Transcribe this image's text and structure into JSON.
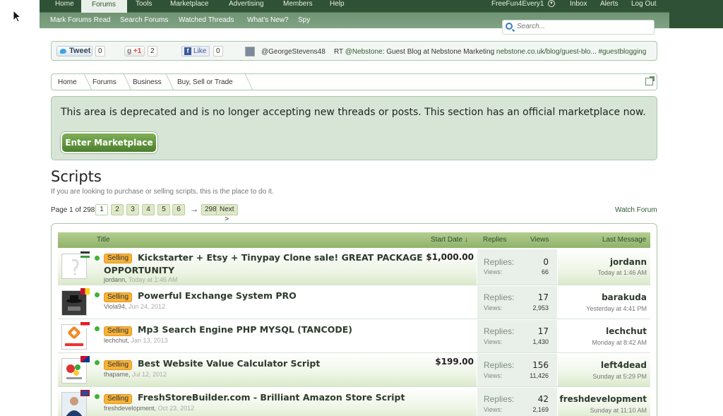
{
  "nav": {
    "items": [
      "Home",
      "Forums",
      "Tools",
      "Marketplace",
      "Advertising",
      "Members",
      "Help"
    ],
    "user": "FreeFun4Every1",
    "inbox": "Inbox",
    "alerts": "Alerts",
    "logout": "Log Out",
    "sub": [
      "Mark Forums Read",
      "Search Forums",
      "Watched Threads",
      "What's New?",
      "Spy"
    ]
  },
  "search": {
    "placeholder": "Search..."
  },
  "social": {
    "tweet": "Tweet",
    "tweet_count": "0",
    "gplus": "+1",
    "gplus_count": "2",
    "like": "Like",
    "like_count": "0",
    "tw_user": "@GeorgeStevens48",
    "tw_rt": "RT",
    "tw_mention": "@Nebstone",
    "tw_msg": ": Guest Blog at Nebstone Marketing",
    "tw_link": "nebstone.co.uk/blog/guest-blo...",
    "tw_tag": "#guestblogging"
  },
  "breadcrumb": [
    "Home",
    "Forums",
    "Business",
    "Buy, Sell or Trade"
  ],
  "notice": {
    "text": "This area is deprecated and is no longer accepting new threads or posts. This section has an official marketplace now.",
    "button": "Enter Marketplace"
  },
  "forum": {
    "title": "Scripts",
    "description": "If you are looking to purchase or selling scripts, this is the place to do it."
  },
  "pager": {
    "label": "Page 1 of 298",
    "pages": [
      "1",
      "2",
      "3",
      "4",
      "5",
      "6"
    ],
    "arrow": "→",
    "last": "298",
    "next": "Next >",
    "watch": "Watch Forum"
  },
  "columns": {
    "title": "Title",
    "start_date": "Start Date ↓",
    "replies": "Replies",
    "views": "Views",
    "last_message": "Last Message"
  },
  "threads": [
    {
      "prefix": "Selling",
      "title_line1": "Kickstarter + Etsy + Tinypay Clone sale! GREAT PACKAGE",
      "title_line2": "OPPORTUNITY",
      "author": "jordann",
      "date": "Today at 1:46 AM",
      "price": "$1,000.00",
      "replies_label": "Replies:",
      "replies": "0",
      "views_label": "Views:",
      "views": "66",
      "last_user": "jordann",
      "last_time": "Today at 1:46 AM"
    },
    {
      "prefix": "Selling",
      "title_line1": "Powerful Exchange System PRO",
      "author": "Viola94",
      "date": "Jun 24, 2012",
      "price": "",
      "replies_label": "Replies:",
      "replies": "17",
      "views_label": "Views:",
      "views": "2,953",
      "last_user": "barakuda",
      "last_time": "Yesterday at 4:41 PM"
    },
    {
      "prefix": "Selling",
      "title_line1": "Mp3 Search Engine PHP MYSQL (TANCODE)",
      "author": "lechchut",
      "date": "Jan 13, 2013",
      "price": "",
      "replies_label": "Replies:",
      "replies": "17",
      "views_label": "Views:",
      "views": "1,430",
      "last_user": "lechchut",
      "last_time": "Monday at 8:42 AM"
    },
    {
      "prefix": "Selling",
      "title_line1": "Best Website Value Calculator Script",
      "author": "thapame",
      "date": "Jul 12, 2012",
      "price": "$199.00",
      "replies_label": "Replies:",
      "replies": "156",
      "views_label": "Views:",
      "views": "11,426",
      "last_user": "left4dead",
      "last_time": "Sunday at 5:29 PM"
    },
    {
      "prefix": "Selling",
      "title_line1": "FreshStoreBuilder.com - Brilliant Amazon Store Script",
      "author": "freshdevelopment",
      "date": "Oct 23, 2012",
      "price": "",
      "replies_label": "Replies:",
      "replies": "42",
      "views_label": "Views:",
      "views": "2,169",
      "last_user": "freshdevelopment",
      "last_time": "Sunday at 11:10 AM"
    }
  ],
  "colors": {
    "nav_dark": "#2f5236",
    "nav_light": "#7fa383",
    "accent": "#4a7f2c",
    "badge": "#f6b23a"
  }
}
